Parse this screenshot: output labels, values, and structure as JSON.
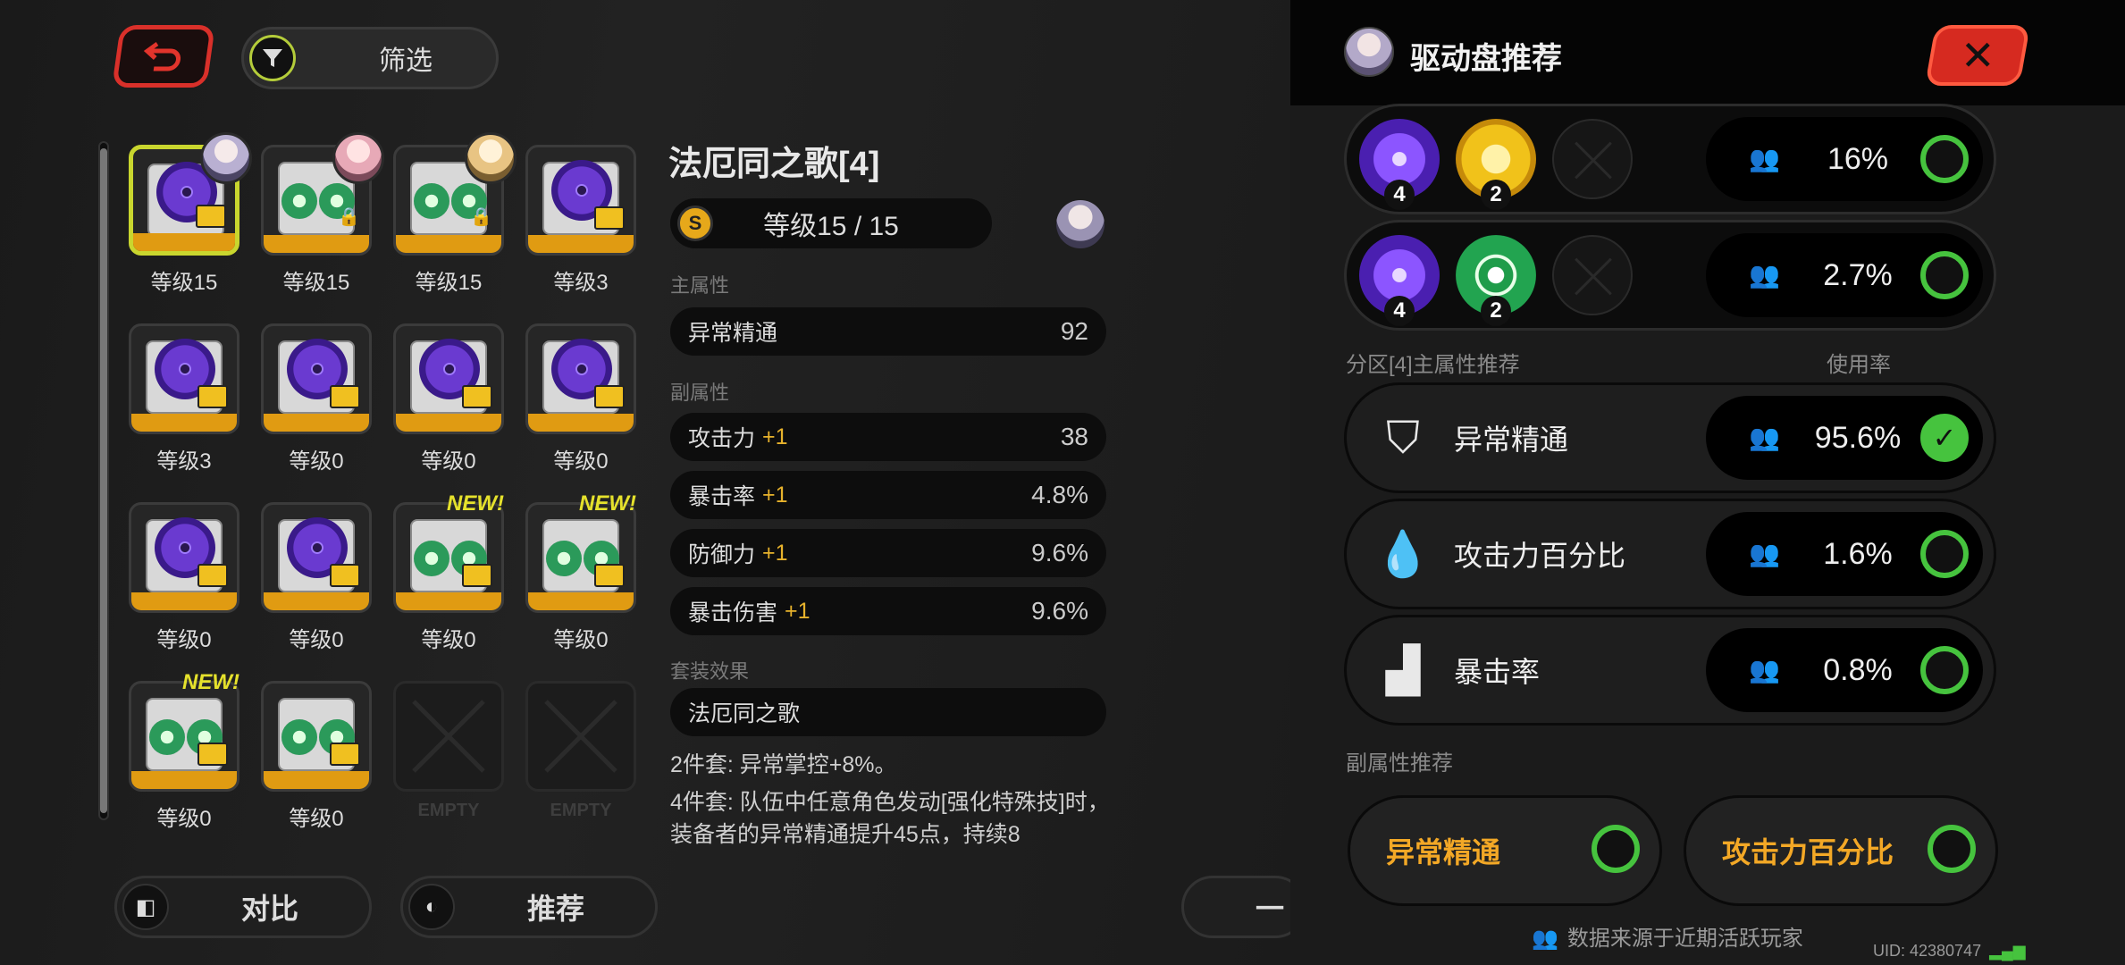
{
  "left": {
    "filter_label": "筛选",
    "disks": [
      {
        "label": "等级15",
        "style": "purple",
        "selected": true,
        "avatar": "lilac"
      },
      {
        "label": "等级15",
        "style": "green",
        "locked": true,
        "avatar": "pink"
      },
      {
        "label": "等级15",
        "style": "green",
        "locked": true,
        "avatar": "blonde"
      },
      {
        "label": "等级3",
        "style": "purple"
      },
      {
        "label": "等级3",
        "style": "purple"
      },
      {
        "label": "等级0",
        "style": "purple"
      },
      {
        "label": "等级0",
        "style": "purple"
      },
      {
        "label": "等级0",
        "style": "purple"
      },
      {
        "label": "等级0",
        "style": "purple"
      },
      {
        "label": "等级0",
        "style": "purple"
      },
      {
        "label": "等级0",
        "style": "green",
        "new": "NEW!"
      },
      {
        "label": "等级0",
        "style": "green",
        "new": "NEW!"
      },
      {
        "label": "等级0",
        "style": "green",
        "new": "NEW!"
      },
      {
        "label": "等级0",
        "style": "green"
      },
      {
        "label": "EMPTY",
        "style": "empty"
      },
      {
        "label": "EMPTY",
        "style": "empty"
      }
    ],
    "detail": {
      "title": "法厄同之歌[4]",
      "level_icon": "S",
      "level": "等级15 / 15",
      "main_label": "主属性",
      "main_stat": {
        "name": "异常精通",
        "value": "92"
      },
      "sub_label": "副属性",
      "sub_stats": [
        {
          "name": "攻击力",
          "plus": "+1",
          "value": "38"
        },
        {
          "name": "暴击率",
          "plus": "+1",
          "value": "4.8%"
        },
        {
          "name": "防御力",
          "plus": "+1",
          "value": "9.6%"
        },
        {
          "name": "暴击伤害",
          "plus": "+1",
          "value": "9.6%"
        }
      ],
      "set_label": "套装效果",
      "set_name": "法厄同之歌",
      "set_2": "2件套: 异常掌控+8%。",
      "set_4": "4件套: 队伍中任意角色发动[强化特殊技]时，装备者的异常精通提升45点，持续8"
    },
    "compare_label": "对比",
    "recommend_label": "推荐",
    "partial_button": "一"
  },
  "panel": {
    "title": "驱动盘推荐",
    "combos": [
      {
        "sets": [
          {
            "style": "purple",
            "count": "4"
          },
          {
            "style": "gold",
            "count": "2"
          },
          {
            "style": "none"
          }
        ],
        "rate": "16%"
      },
      {
        "sets": [
          {
            "style": "purple",
            "count": "4"
          },
          {
            "style": "green",
            "count": "2"
          },
          {
            "style": "none"
          }
        ],
        "rate": "2.7%"
      }
    ],
    "main_section_label": "分区[4]主属性推荐",
    "usage_label": "使用率",
    "main_options": [
      {
        "icon": "shield-icon",
        "name": "异常精通",
        "rate": "95.6%",
        "checked": true
      },
      {
        "icon": "drop-icon",
        "name": "攻击力百分比",
        "rate": "1.6%",
        "checked": false
      },
      {
        "icon": "crit-icon",
        "name": "暴击率",
        "rate": "0.8%",
        "checked": false
      }
    ],
    "sub_section_label": "副属性推荐",
    "sub_options": [
      {
        "name": "异常精通"
      },
      {
        "name": "攻击力百分比"
      }
    ],
    "footer": "数据来源于近期活跃玩家",
    "uid": "UID: 42380747"
  }
}
